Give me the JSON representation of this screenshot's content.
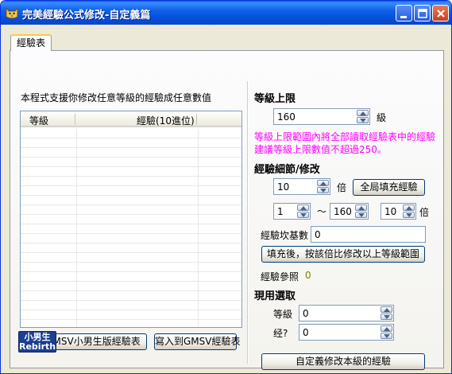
{
  "window": {
    "title": "完美經驗公式修改-自定義篇",
    "controls": [
      "minimize-icon",
      "maximize-icon",
      "close-icon"
    ]
  },
  "tab": {
    "label": "經驗表"
  },
  "left": {
    "description": "本程式支援你修改任意等級的經驗成任意數值",
    "table": {
      "columns": [
        "等級",
        "經驗(10進位)"
      ],
      "rows": []
    },
    "view_button": "檢視GMSV小男生版經驗表",
    "write_button": "寫入到GMSV經驗表",
    "logo": {
      "line1": "小男生",
      "line2": "Rebirth"
    }
  },
  "level_limit": {
    "heading": "等級上限",
    "value": "160",
    "unit": "級",
    "note_line1": "等級上限範圍內將全部讀取經驗表中的經驗",
    "note_line2": "建議等級上限數值不超過250。"
  },
  "exp_modify": {
    "heading": "經驗細節/修改",
    "multiplier": "10",
    "multiplier_unit": "倍",
    "fill_all_button": "全局填充經驗",
    "range_from": "1",
    "range_sep": "～",
    "range_to": "160",
    "range_multiplier": "10",
    "range_unit": "倍",
    "base_label": "經驗坎基數",
    "base_value": "0",
    "fill_range_button": "填充後，按該倍比修改以上等級範圍",
    "ref_label": "經驗參照",
    "ref_value": "0"
  },
  "current": {
    "heading": "現用選取",
    "level_label": "等級",
    "level_value": "0",
    "exp_label": "经?",
    "exp_value": "0",
    "custom_button": "自定義修改本級的經驗"
  },
  "colors": {
    "accent_title": "#0551dc",
    "note": "#ff00ff",
    "ref": "#808000"
  }
}
